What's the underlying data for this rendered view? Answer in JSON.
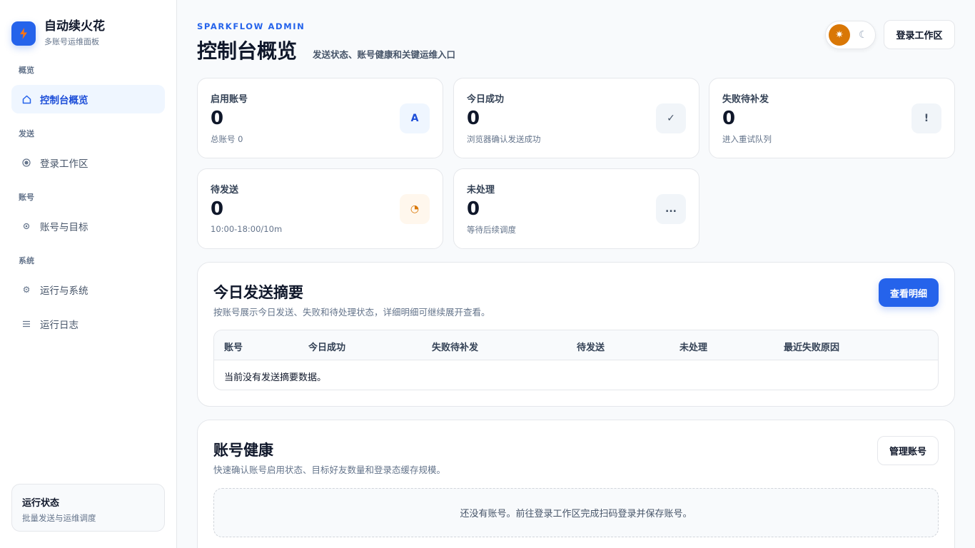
{
  "sidebar": {
    "brand_title": "自动续火花",
    "brand_sub": "多账号运维面板",
    "groups": [
      "概览",
      "发送",
      "账号",
      "系统"
    ],
    "items": [
      {
        "label": "控制台概览",
        "icon": "home-icon"
      },
      {
        "label": "登录工作区",
        "icon": "target-icon"
      },
      {
        "label": "账号与目标",
        "icon": "dot-icon"
      },
      {
        "label": "运行与系统",
        "icon": "gear-icon"
      },
      {
        "label": "运行日志",
        "icon": "list-icon"
      }
    ],
    "status_title": "运行状态",
    "status_sub": "批量发送与运维调度"
  },
  "header": {
    "eyebrow": "SPARKFLOW ADMIN",
    "title": "控制台概览",
    "subtitle": "发送状态、账号健康和关键运维入口",
    "login_button": "登录工作区"
  },
  "stats": [
    {
      "label": "启用账号",
      "value": "0",
      "sub": "总账号 0",
      "icon": "A"
    },
    {
      "label": "今日成功",
      "value": "0",
      "sub": "浏览器确认发送成功",
      "icon": "✓"
    },
    {
      "label": "失败待补发",
      "value": "0",
      "sub": "进入重试队列",
      "icon": "!"
    },
    {
      "label": "待发送",
      "value": "0",
      "sub": "10:00-18:00/10m",
      "icon": "◔"
    },
    {
      "label": "未处理",
      "value": "0",
      "sub": "等待后续调度",
      "icon": "..."
    }
  ],
  "summary": {
    "title": "今日发送摘要",
    "subtitle": "按账号展示今日发送、失败和待处理状态，详细明细可继续展开查看。",
    "button": "查看明细",
    "columns": [
      "账号",
      "今日成功",
      "失败待补发",
      "待发送",
      "未处理",
      "最近失败原因"
    ],
    "empty": "当前没有发送摘要数据。"
  },
  "health": {
    "title": "账号健康",
    "subtitle": "快速确认账号启用状态、目标好友数量和登录态缓存规模。",
    "button": "管理账号",
    "empty": "还没有账号。前往登录工作区完成扫码登录并保存账号。"
  },
  "colors": {
    "accent": "#2563eb",
    "orange": "#d97706"
  }
}
